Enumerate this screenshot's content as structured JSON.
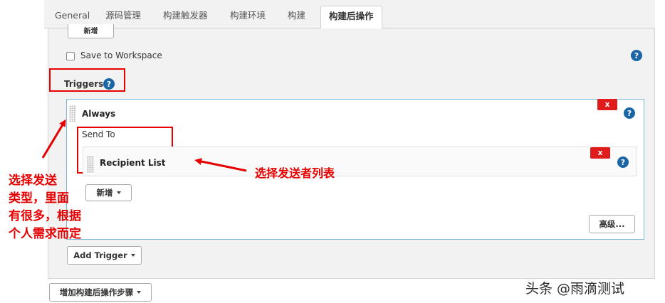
{
  "tabs": [
    {
      "label": "General"
    },
    {
      "label": "源码管理"
    },
    {
      "label": "构建触发器"
    },
    {
      "label": "构建环境"
    },
    {
      "label": "构建"
    },
    {
      "label": "构建后操作"
    }
  ],
  "active_tab_index": 5,
  "top_add_button": "新增",
  "save_to_workspace": {
    "label": "Save to Workspace",
    "checked": false
  },
  "triggers_label": "Triggers",
  "trigger_always": {
    "title": "Always",
    "close_label": "x",
    "send_to_label": "Send To",
    "recipient_list": {
      "title": "Recipient List",
      "close_label": "x"
    },
    "add_button": "新增",
    "advanced_button": "高级..."
  },
  "add_trigger_button": "Add Trigger",
  "add_post_build_button": "增加构建后操作步骤",
  "help_glyph": "?",
  "annotations": {
    "left_note": [
      "选择发送",
      "类型，里面",
      "有很多，根据",
      "个人需求而定"
    ],
    "right_note": "选择发送者列表"
  },
  "watermark": "头条 @雨滴测试",
  "colors": {
    "accent_red": "#e60000",
    "help_blue": "#1a65a6",
    "close_red": "#e01b1b"
  }
}
